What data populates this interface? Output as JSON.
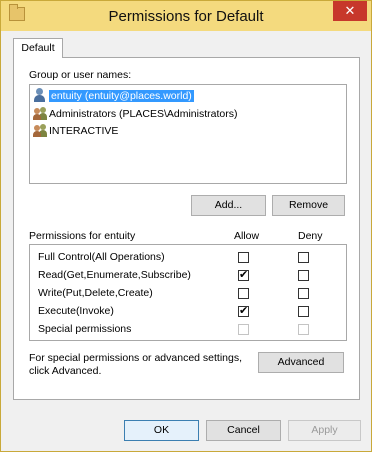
{
  "window": {
    "title": "Permissions for Default",
    "close_symbol": "✕"
  },
  "tab": {
    "label": "Default"
  },
  "group_section": {
    "label": "Group or user names:"
  },
  "users": [
    {
      "name": "entuity (entuity@places.world)",
      "icon": "user-icon",
      "selected": true
    },
    {
      "name": "Administrators (PLACES\\Administrators)",
      "icon": "group-icon",
      "selected": false
    },
    {
      "name": "INTERACTIVE",
      "icon": "group-icon",
      "selected": false
    }
  ],
  "user_buttons": {
    "add": "Add...",
    "remove": "Remove"
  },
  "permissions": {
    "title": "Permissions for entuity",
    "allow_header": "Allow",
    "deny_header": "Deny",
    "rows": [
      {
        "name": "Full Control(All Operations)",
        "allow": false,
        "deny": false,
        "disabled": false
      },
      {
        "name": "Read(Get,Enumerate,Subscribe)",
        "allow": true,
        "deny": false,
        "disabled": false
      },
      {
        "name": "Write(Put,Delete,Create)",
        "allow": false,
        "deny": false,
        "disabled": false
      },
      {
        "name": "Execute(Invoke)",
        "allow": true,
        "deny": false,
        "disabled": false
      },
      {
        "name": "Special permissions",
        "allow": false,
        "deny": false,
        "disabled": true
      }
    ]
  },
  "advanced": {
    "text_line1": "For special permissions or advanced settings,",
    "text_line2": "click Advanced.",
    "button": "Advanced"
  },
  "dialog_buttons": {
    "ok": "OK",
    "cancel": "Cancel",
    "apply": "Apply"
  },
  "check_glyph": "✔"
}
